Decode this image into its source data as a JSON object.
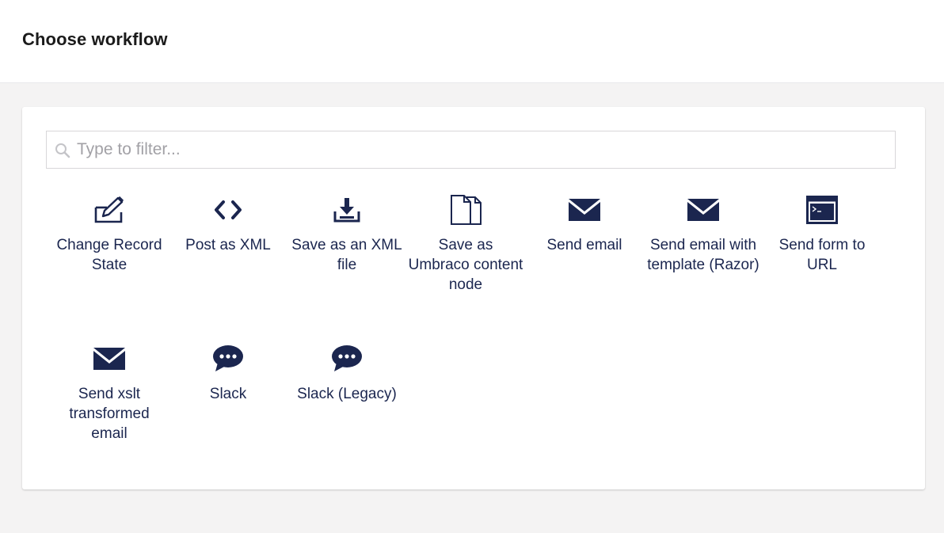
{
  "header": {
    "title": "Choose workflow"
  },
  "filter": {
    "placeholder": "Type to filter...",
    "value": ""
  },
  "workflows": [
    {
      "label": "Change Record State",
      "icon": "edit-icon"
    },
    {
      "label": "Post as XML",
      "icon": "code-icon"
    },
    {
      "label": "Save as an XML file",
      "icon": "download-icon"
    },
    {
      "label": "Save as Umbraco content node",
      "icon": "documents-icon"
    },
    {
      "label": "Send email",
      "icon": "envelope-icon"
    },
    {
      "label": "Send email with template (Razor)",
      "icon": "envelope-icon"
    },
    {
      "label": "Send form to URL",
      "icon": "terminal-icon"
    },
    {
      "label": "Send xslt transformed email",
      "icon": "envelope-icon"
    },
    {
      "label": "Slack",
      "icon": "chat-icon"
    },
    {
      "label": "Slack (Legacy)",
      "icon": "chat-icon"
    }
  ],
  "colors": {
    "icon": "#1b264f",
    "text": "#1b264f",
    "placeholder": "#a2a1a6",
    "background": "#f4f3f3"
  }
}
